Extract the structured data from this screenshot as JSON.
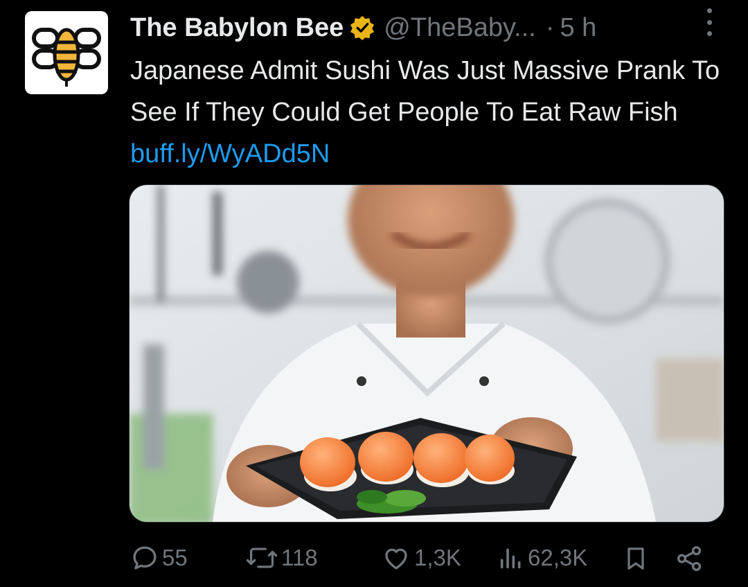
{
  "tweet": {
    "display_name": "The Babylon Bee",
    "handle": "@TheBaby...",
    "separator": "·",
    "time": "5 h",
    "text": "Japanese Admit Sushi Was Just Massive Prank To See If They Could Get People To Eat Raw Fish",
    "link": "buff.ly/WyADd5N",
    "avatar_icon": "babylon-bee-logo",
    "verified_icon": "verified-badge-icon",
    "more_icon": "more-vertical-icon"
  },
  "media": {
    "description_icon": "chef-sushi-photo"
  },
  "actions": {
    "replies": "55",
    "reposts": "118",
    "likes": "1,3K",
    "views": "62,3K",
    "reply_icon": "reply-icon",
    "repost_icon": "repost-icon",
    "like_icon": "heart-icon",
    "views_icon": "views-icon",
    "bookmark_icon": "bookmark-icon",
    "share_icon": "share-icon"
  },
  "colors": {
    "background": "#000000",
    "text": "#e7e9ea",
    "muted": "#71767b",
    "link": "#1d9bf0",
    "verified": "#e8b417"
  }
}
